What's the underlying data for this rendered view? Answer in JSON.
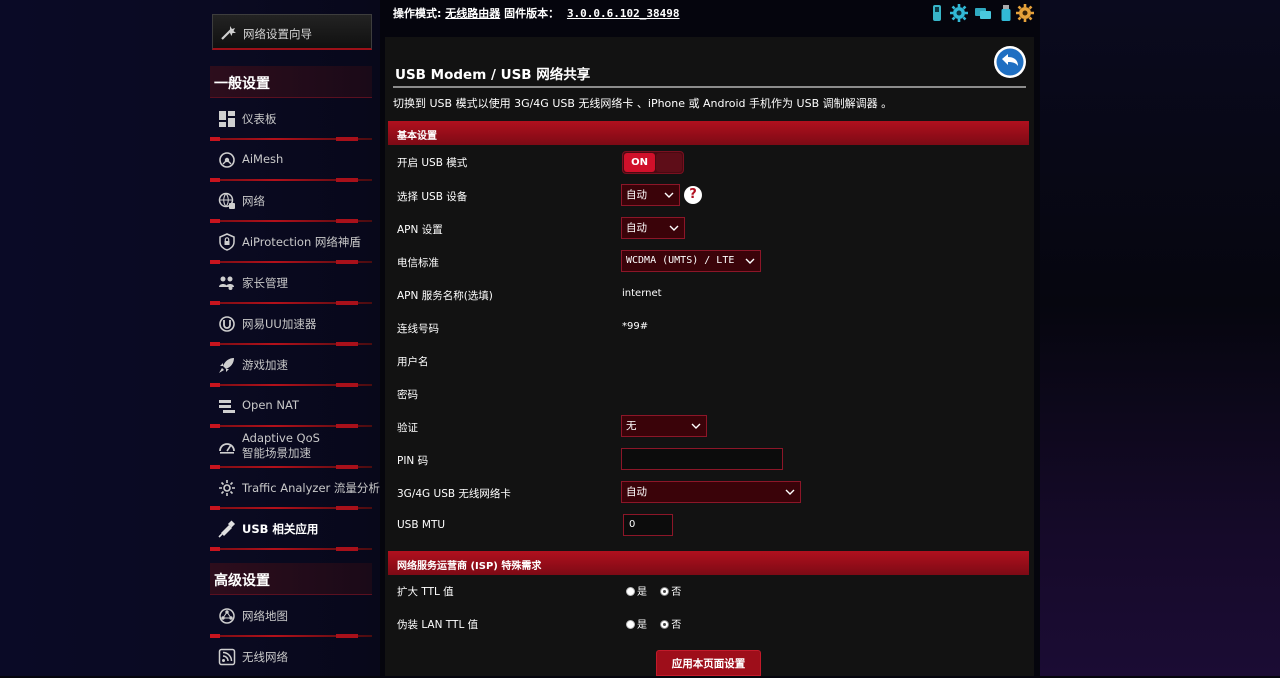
{
  "header": {
    "opmode_label": "操作模式:",
    "opmode_value": "无线路由器",
    "firmware_label": "固件版本：",
    "firmware_value": "3.0.0.6.102_38498"
  },
  "sidebar": {
    "wizard": "网络设置向导",
    "general_title": "一般设置",
    "general_items": [
      {
        "label": "仪表板"
      },
      {
        "label": "AiMesh"
      },
      {
        "label": "网络"
      },
      {
        "label": "AiProtection 网络神盾"
      },
      {
        "label": "家长管理"
      },
      {
        "label": "网易UU加速器"
      },
      {
        "label": "游戏加速"
      },
      {
        "label": "Open NAT"
      },
      {
        "label": "Adaptive QoS",
        "sub": "智能场景加速"
      },
      {
        "label": "Traffic Analyzer 流量分析"
      },
      {
        "label": "USB 相关应用"
      }
    ],
    "advanced_title": "高级设置",
    "advanced_items": [
      {
        "label": "网络地图"
      },
      {
        "label": "无线网络"
      }
    ]
  },
  "main": {
    "title": "USB Modem / USB 网络共享",
    "description": "切换到 USB 模式以使用 3G/4G USB 无线网络卡 、iPhone 或 Android 手机作为 USB 调制解调器 。",
    "basic_section": "基本设置",
    "rows": {
      "enable_usb": {
        "label": "开启 USB 模式",
        "value": "ON"
      },
      "select_device": {
        "label": "选择 USB 设备",
        "value": "自动"
      },
      "apn_setting": {
        "label": "APN 设置",
        "value": "自动"
      },
      "telecom_standard": {
        "label": "电信标准",
        "value": "WCDMA (UMTS) / LTE"
      },
      "apn_name": {
        "label": "APN 服务名称(选填)",
        "value": "internet"
      },
      "dial_number": {
        "label": "连线号码",
        "value": "*99#"
      },
      "username": {
        "label": "用户名",
        "value": ""
      },
      "password": {
        "label": "密码",
        "value": ""
      },
      "auth": {
        "label": "验证",
        "value": "无"
      },
      "pin": {
        "label": "PIN 码",
        "value": ""
      },
      "usb_adapter": {
        "label": "3G/4G USB 无线网络卡",
        "value": "自动"
      },
      "usb_mtu": {
        "label": "USB MTU",
        "value": "0"
      }
    },
    "isp_section": "网络服务运营商 (ISP) 特殊需求",
    "isp_rows": {
      "extend_ttl": {
        "label": "扩大 TTL 值",
        "yes": "是",
        "no": "否",
        "selected": "no"
      },
      "spoof_lan_ttl": {
        "label": "伪装 LAN TTL 值",
        "yes": "是",
        "no": "否",
        "selected": "no"
      }
    },
    "apply_button": "应用本页面设置"
  },
  "icons": {
    "wizard": "wizard-icon",
    "top": [
      "usb-icon",
      "settings-gear-icon",
      "network-icon",
      "usb-drive-icon",
      "gear-icon"
    ]
  }
}
